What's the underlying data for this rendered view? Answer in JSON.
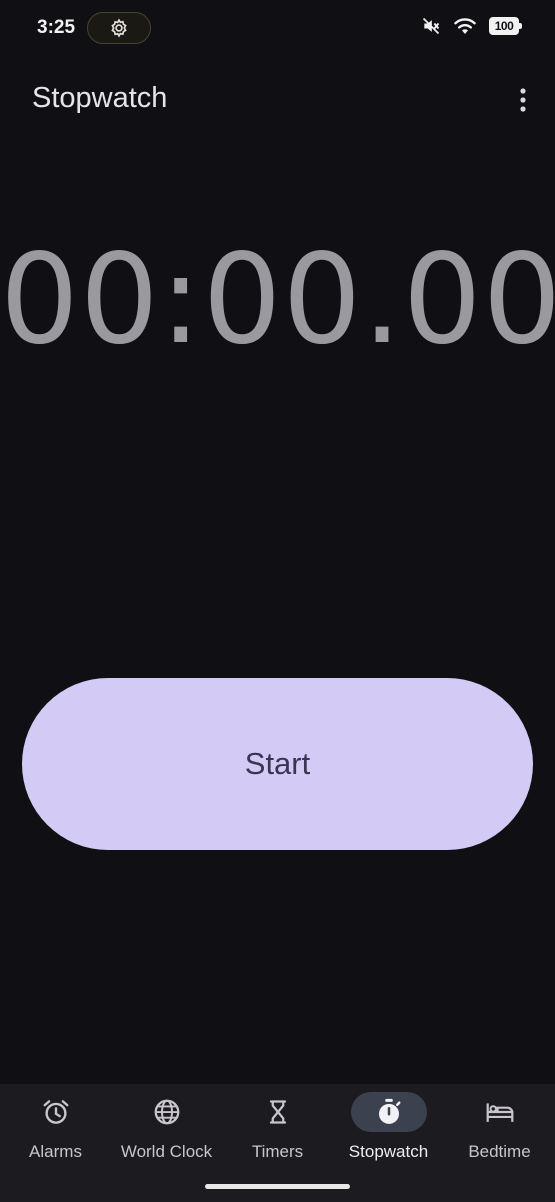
{
  "status_bar": {
    "time": "3:25",
    "battery": "100",
    "icons": [
      "settings-icon",
      "mute-icon",
      "wifi-icon",
      "battery-icon"
    ]
  },
  "app_bar": {
    "title": "Stopwatch",
    "menu_icon": "more-vert-icon"
  },
  "stopwatch": {
    "display": "00:00.00"
  },
  "actions": {
    "start_label": "Start"
  },
  "bottom_nav": {
    "items": [
      {
        "label": "Alarms",
        "icon": "alarm-icon",
        "active": false
      },
      {
        "label": "World Clock",
        "icon": "globe-icon",
        "active": false
      },
      {
        "label": "Timers",
        "icon": "hourglass-icon",
        "active": false
      },
      {
        "label": "Stopwatch",
        "icon": "stopwatch-icon",
        "active": true
      },
      {
        "label": "Bedtime",
        "icon": "bed-icon",
        "active": false
      }
    ]
  },
  "colors": {
    "background": "#101014",
    "start_button": "#d3cbf5",
    "nav_background": "#1c1b20",
    "nav_active_pill": "#3c4150",
    "timer_text": "#9a999f"
  }
}
